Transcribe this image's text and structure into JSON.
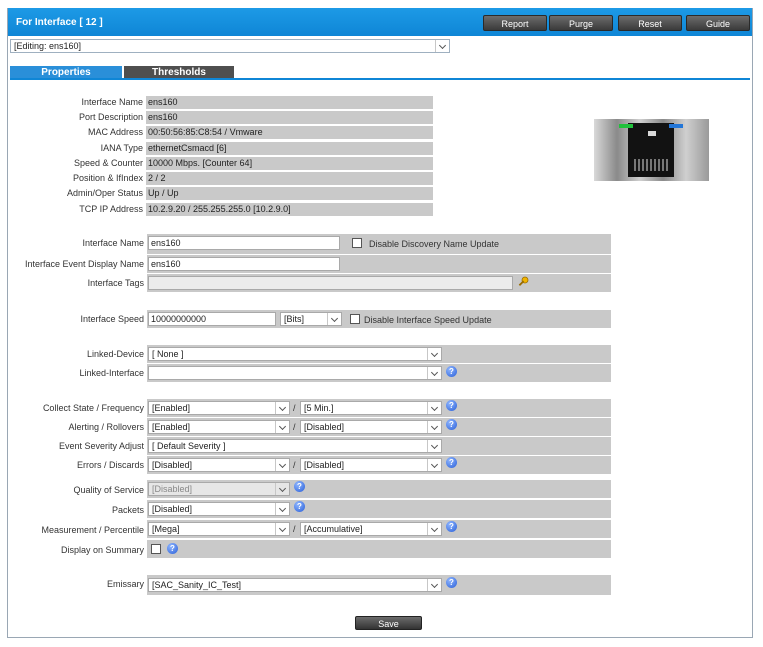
{
  "window": {
    "title": "For Interface [ 12 ]",
    "buttons": [
      "Report",
      "Purge",
      "Reset",
      "Guide"
    ]
  },
  "editing_select": "[Editing: ens160]",
  "tabs": [
    "Properties",
    "Thresholds"
  ],
  "info": [
    {
      "label": "Interface Name",
      "value": "ens160"
    },
    {
      "label": "Port Description",
      "value": "ens160"
    },
    {
      "label": "MAC Address",
      "value": "00:50:56:85:C8:54 / Vmware"
    },
    {
      "label": "IANA Type",
      "value": "ethernetCsmacd [6]"
    },
    {
      "label": "Speed & Counter",
      "value": "10000 Mbps. [Counter 64]"
    },
    {
      "label": "Position & IfIndex",
      "value": "2 / 2"
    },
    {
      "label": "Admin/Oper Status",
      "value": "Up / Up"
    },
    {
      "label": "TCP IP Address",
      "value": "10.2.9.20 / 255.255.255.0 [10.2.9.0]"
    }
  ],
  "form": {
    "interface_name_label": "Interface Name",
    "interface_name_value": "ens160",
    "disable_discovery_label": "Disable Discovery Name Update",
    "event_display_name_label": "Interface Event Display Name",
    "event_display_name_value": "ens160",
    "tags_label": "Interface Tags",
    "tags_value": "",
    "speed_label": "Interface Speed",
    "speed_value": "10000000000",
    "speed_unit": "[Bits]",
    "disable_speed_label": "Disable Interface Speed Update",
    "linked_device_label": "Linked-Device",
    "linked_device_value": "[ None ]",
    "linked_interface_label": "Linked-Interface",
    "linked_interface_value": "",
    "collect_label": "Collect State / Frequency",
    "collect_state": "[Enabled]",
    "collect_freq": "[5 Min.]",
    "alerting_label": "Alerting / Rollovers",
    "alerting_value": "[Enabled]",
    "rollovers_value": "[Disabled]",
    "severity_label": "Event Severity Adjust",
    "severity_value": "[ Default Severity ]",
    "errors_label": "Errors / Discards",
    "errors_value": "[Disabled]",
    "discards_value": "[Disabled]",
    "qos_label": "Quality of Service",
    "qos_value": "[Disabled]",
    "packets_label": "Packets",
    "packets_value": "[Disabled]",
    "measurement_label": "Measurement / Percentile",
    "measurement_value": "[Mega]",
    "percentile_value": "[Accumulative]",
    "display_summary_label": "Display on Summary",
    "emissary_label": "Emissary",
    "emissary_value": "[SAC_Sanity_IC_Test]",
    "slash": "/"
  },
  "save_label": "Save",
  "colors": {
    "titlebar": "#1d9ae6",
    "active_tab": "#2a8fd9",
    "inactive_tab": "#4f4f4f",
    "field_bg": "#c9c9c9"
  }
}
